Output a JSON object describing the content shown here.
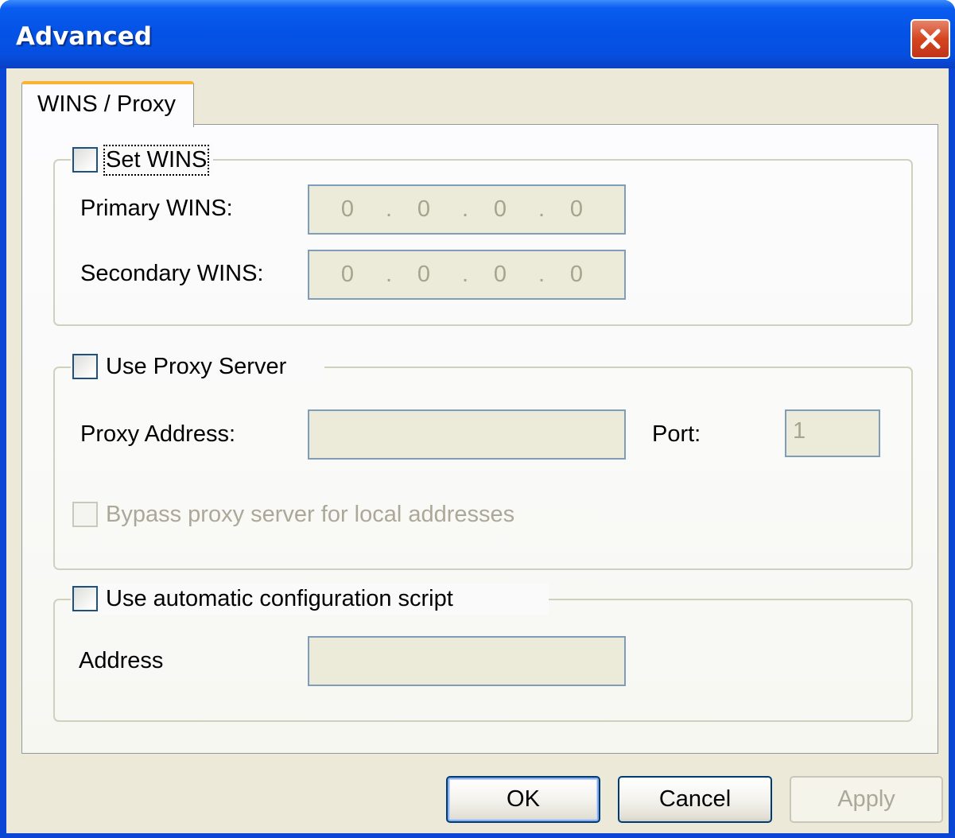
{
  "window": {
    "title": "Advanced"
  },
  "tabs": [
    {
      "label": "WINS / Proxy",
      "selected": true
    }
  ],
  "wins": {
    "checkbox_label": "Set WINS",
    "checked": false,
    "primary_label": "Primary WINS:",
    "primary_value": [
      "0",
      "0",
      "0",
      "0"
    ],
    "secondary_label": "Secondary WINS:",
    "secondary_value": [
      "0",
      "0",
      "0",
      "0"
    ]
  },
  "proxy": {
    "checkbox_label": "Use Proxy Server",
    "checked": false,
    "address_label": "Proxy Address:",
    "address_value": "",
    "port_label": "Port:",
    "port_value": "1",
    "bypass_label": "Bypass proxy server for local addresses",
    "bypass_checked": false
  },
  "autoconfig": {
    "checkbox_label": "Use automatic configuration script",
    "checked": false,
    "address_label": "Address",
    "address_value": ""
  },
  "buttons": {
    "ok": "OK",
    "cancel": "Cancel",
    "apply": "Apply"
  },
  "ip_separator": ".",
  "icons": {
    "close": "close-icon",
    "checkbox": "checkbox-unchecked-icon"
  },
  "colors": {
    "titlebar": "#0453e6",
    "dialog_bg": "#ece9d8",
    "tab_highlight": "#f8b330",
    "close_button": "#d6451f",
    "disabled_text": "#aca899"
  }
}
